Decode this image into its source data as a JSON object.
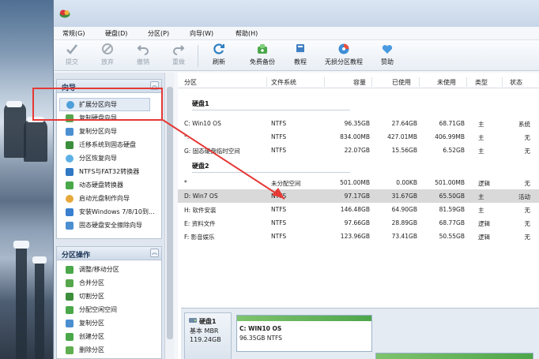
{
  "menu": [
    "常规(G)",
    "硬盘(D)",
    "分区(P)",
    "向导(W)",
    "帮助(H)"
  ],
  "toolbar": {
    "submit": "提交",
    "discard": "放弃",
    "undo": "撤销",
    "redo": "重做",
    "refresh": "刷新",
    "backup": "免费备份",
    "tutorial": "教程",
    "lossless": "无损分区教程",
    "help": "赞助"
  },
  "wizard_panel": {
    "title": "向导",
    "items": [
      "扩展分区向导",
      "复制硬盘向导",
      "复制分区向导",
      "迁移系统到固态硬盘",
      "分区恢复向导",
      "NTFS与FAT32转换器",
      "动态硬盘转换器",
      "启动光盘制作向导",
      "安装Windows 7/8/10到...",
      "固态硬盘安全擦除向导"
    ]
  },
  "ops_panel": {
    "title": "分区操作",
    "items": [
      "调整/移动分区",
      "合并分区",
      "切割分区",
      "分配空闲空间",
      "复制分区",
      "创建分区",
      "删除分区"
    ]
  },
  "table": {
    "headers": [
      "分区",
      "文件系统",
      "容量",
      "已使用",
      "未使用",
      "类型",
      "状态"
    ],
    "disk1_label": "硬盘1",
    "disk2_label": "硬盘2",
    "disk1_rows": [
      [
        "C: Win10 OS",
        "NTFS",
        "96.35GB",
        "27.64GB",
        "68.71GB",
        "主",
        "系统"
      ],
      [
        "*:",
        "NTFS",
        "834.00MB",
        "427.01MB",
        "406.99MB",
        "主",
        "无"
      ],
      [
        "G: 固态硬盘临时空间",
        "NTFS",
        "22.07GB",
        "15.56GB",
        "6.52GB",
        "主",
        "无"
      ]
    ],
    "disk2_rows": [
      [
        "*",
        "未分配空间",
        "501.00MB",
        "0.00KB",
        "501.00MB",
        "逻辑",
        "无"
      ],
      [
        "D: Win7 OS",
        "NTFS",
        "97.17GB",
        "31.67GB",
        "65.50GB",
        "主",
        "活动"
      ],
      [
        "H: 软件安装",
        "NTFS",
        "146.48GB",
        "64.90GB",
        "81.59GB",
        "主",
        "无"
      ],
      [
        "E: 资料文件",
        "NTFS",
        "97.66GB",
        "28.89GB",
        "68.77GB",
        "逻辑",
        "无"
      ],
      [
        "F: 影音娱乐",
        "NTFS",
        "123.96GB",
        "73.41GB",
        "50.55GB",
        "逻辑",
        "无"
      ]
    ]
  },
  "disk_map": {
    "name": "硬盘1",
    "type": "基本 MBR",
    "size": "119.24GB",
    "partition_name": "C: WIN10 OS",
    "partition_info": "96.35GB NTFS"
  },
  "colors": {
    "highlight": "#e53935",
    "usage_bar": "#4ea64a",
    "selected_row": "#d9d9d9"
  }
}
